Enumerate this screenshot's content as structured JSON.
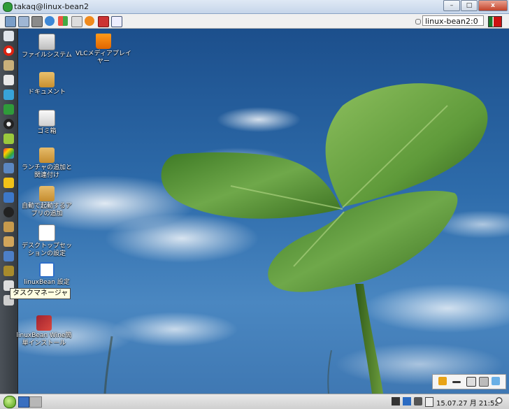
{
  "window": {
    "title": "takaq@linux-bean2",
    "min": "–",
    "max": "□",
    "close": "x"
  },
  "toolbar": {
    "host": "linux-bean2:0"
  },
  "desktop_icons": [
    {
      "label": "ファイルシステム"
    },
    {
      "label": "VLCメディアプレイヤー"
    },
    {
      "label": "ドキュメント"
    },
    {
      "label": "ゴミ箱"
    },
    {
      "label": "ランチャの追加と関連付け"
    },
    {
      "label": "自動で起動するアプリの追加"
    },
    {
      "label": "デスクトップセッションの設定"
    },
    {
      "label": "linuxBean 設定"
    },
    {
      "label": "linuxBean Wine簡単インストール"
    }
  ],
  "tooltip": "タスクマネージャ",
  "taskbar": {
    "clock": "15.07.27 月 21:52"
  },
  "colors": {
    "sky": "#2e6cab",
    "leaf": "#5f9a3a",
    "dock": "#3c4248"
  }
}
